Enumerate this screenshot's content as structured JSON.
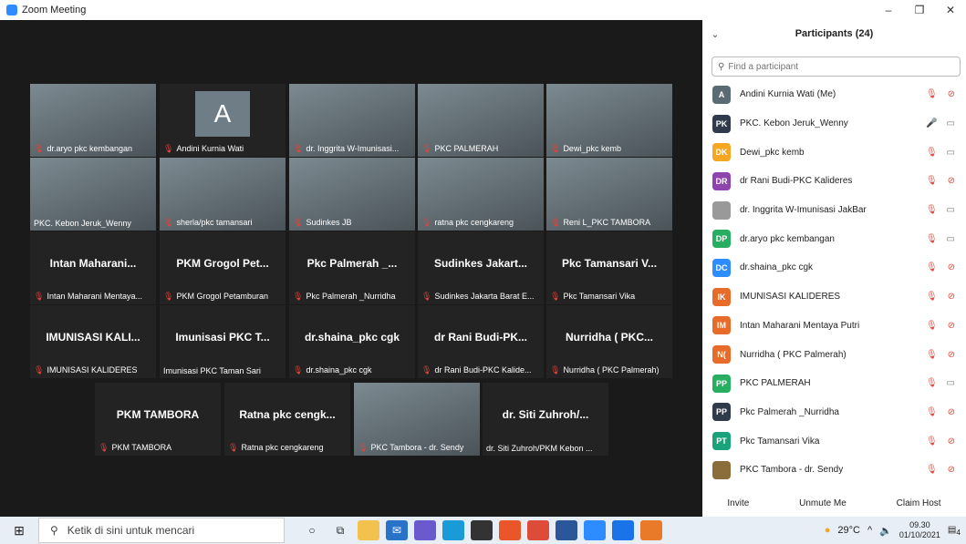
{
  "window": {
    "title": "Zoom Meeting",
    "controls": [
      "–",
      "❐",
      "✕"
    ]
  },
  "gallery": {
    "tiles": [
      {
        "label": "dr.aryo pkc kembangan",
        "type": "video",
        "muted": true
      },
      {
        "label": "Andini Kurnia Wati",
        "type": "avatar",
        "avatar": "A",
        "muted": true
      },
      {
        "label": "dr. Inggrita W-Imunisasi...",
        "type": "video",
        "muted": true
      },
      {
        "label": "PKC PALMERAH",
        "type": "video",
        "muted": true
      },
      {
        "label": "Dewi_pkc kemb",
        "type": "video",
        "muted": true
      },
      {
        "label": "PKC. Kebon Jeruk_Wenny",
        "type": "video",
        "muted": false,
        "active": true
      },
      {
        "label": "sherla/pkc tamansari",
        "type": "video",
        "muted": true
      },
      {
        "label": "Sudinkes JB",
        "type": "video",
        "muted": true
      },
      {
        "label": "ratna pkc cengkareng",
        "type": "video",
        "muted": true
      },
      {
        "label": "Reni L_PKC TAMBORA",
        "type": "video",
        "muted": true
      },
      {
        "title": "Intan Maharani...",
        "label": "Intan Maharani Mentaya...",
        "type": "name",
        "muted": true
      },
      {
        "title": "PKM Grogol Pet...",
        "label": "PKM Grogol Petamburan",
        "type": "name",
        "muted": true
      },
      {
        "title": "Pkc Palmerah _...",
        "label": "Pkc Palmerah _Nurridha",
        "type": "name",
        "muted": true
      },
      {
        "title": "Sudinkes Jakart...",
        "label": "Sudinkes Jakarta Barat E...",
        "type": "name",
        "muted": true
      },
      {
        "title": "Pkc Tamansari V...",
        "label": "Pkc Tamansari Vika",
        "type": "name",
        "muted": true
      },
      {
        "title": "IMUNISASI KALI...",
        "label": "IMUNISASI KALIDERES",
        "type": "name",
        "muted": true
      },
      {
        "title": "Imunisasi PKC T...",
        "label": "Imunisasi PKC Taman Sari",
        "type": "name",
        "muted": false
      },
      {
        "title": "dr.shaina_pkc cgk",
        "label": "dr.shaina_pkc cgk",
        "type": "name",
        "muted": true
      },
      {
        "title": "dr Rani Budi-PK...",
        "label": "dr Rani Budi-PKC Kalide...",
        "type": "name",
        "muted": true
      },
      {
        "title": "Nurridha ( PKC...",
        "label": "Nurridha ( PKC Palmerah)",
        "type": "name",
        "muted": true
      },
      {
        "title": "PKM TAMBORA",
        "label": "PKM TAMBORA",
        "type": "name",
        "muted": true
      },
      {
        "title": "Ratna pkc cengk...",
        "label": "Ratna pkc cengkareng",
        "type": "name",
        "muted": true
      },
      {
        "label": "PKC Tambora - dr. Sendy",
        "type": "video",
        "muted": true
      },
      {
        "title": "dr. Siti Zuhroh/...",
        "label": "dr. Siti Zuhroh/PKM Kebon ...",
        "type": "name",
        "muted": false
      }
    ]
  },
  "participants": {
    "title": "Participants (24)",
    "search_placeholder": "Find a participant",
    "items": [
      {
        "initials": "A",
        "name": "Andini Kurnia Wati (Me)",
        "color": "#5b6b74",
        "mic": "off",
        "video": "off"
      },
      {
        "initials": "PK",
        "name": "PKC. Kebon Jeruk_Wenny",
        "color": "#2f3a4a",
        "mic": "on",
        "video": "on"
      },
      {
        "initials": "DK",
        "name": "Dewi_pkc kemb",
        "color": "#f5a623",
        "mic": "off",
        "video": "on"
      },
      {
        "initials": "DR",
        "name": "dr Rani Budi-PKC Kalideres",
        "color": "#8e44ad",
        "mic": "off",
        "video": "off"
      },
      {
        "initials": "",
        "name": "dr. Inggrita W-Imunisasi JakBar",
        "color": "#999999",
        "mic": "off",
        "video": "on"
      },
      {
        "initials": "DP",
        "name": "dr.aryo pkc kembangan",
        "color": "#27ae60",
        "mic": "off",
        "video": "on"
      },
      {
        "initials": "DC",
        "name": "dr.shaina_pkc cgk",
        "color": "#2d8cff",
        "mic": "off",
        "video": "off"
      },
      {
        "initials": "IK",
        "name": "IMUNISASI KALIDERES",
        "color": "#e86b2a",
        "mic": "off",
        "video": "off"
      },
      {
        "initials": "IM",
        "name": "Intan Maharani Mentaya Putri",
        "color": "#e86b2a",
        "mic": "off",
        "video": "off"
      },
      {
        "initials": "N(",
        "name": "Nurridha ( PKC Palmerah)",
        "color": "#e86b2a",
        "mic": "off",
        "video": "off"
      },
      {
        "initials": "PP",
        "name": "PKC PALMERAH",
        "color": "#27ae60",
        "mic": "off",
        "video": "on"
      },
      {
        "initials": "PP",
        "name": "Pkc Palmerah _Nurridha",
        "color": "#2f3a4a",
        "mic": "off",
        "video": "off"
      },
      {
        "initials": "PT",
        "name": "Pkc Tamansari Vika",
        "color": "#1aa37a",
        "mic": "off",
        "video": "off"
      },
      {
        "initials": "",
        "name": "PKC Tambora - dr. Sendy",
        "color": "#8a6d3b",
        "mic": "off",
        "video": "off"
      }
    ],
    "footer": {
      "invite": "Invite",
      "unmute": "Unmute Me",
      "claim": "Claim Host"
    }
  },
  "taskbar": {
    "search_placeholder": "Ketik di sini untuk mencari",
    "weather": "29°C",
    "time": "09.30",
    "date": "01/10/2021",
    "notif_count": "4"
  }
}
